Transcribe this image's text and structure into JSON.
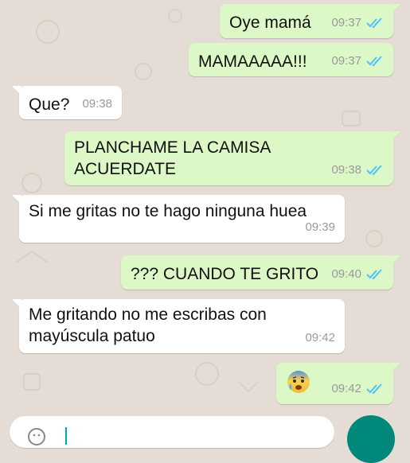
{
  "chat": {
    "messages": [
      {
        "dir": "out",
        "text": "Oye mamá",
        "time": "09:37",
        "status": "read"
      },
      {
        "dir": "out",
        "text": "MAMAAAAA!!!",
        "time": "09:37",
        "status": "read"
      },
      {
        "dir": "in",
        "text": "Que?",
        "time": "09:38"
      },
      {
        "dir": "out",
        "line1": "PLANCHAME LA CAMISA",
        "line2": "ACUERDATE",
        "time": "09:38",
        "status": "read"
      },
      {
        "dir": "in",
        "text": "Si me gritas no te hago ninguna huea",
        "time": "09:39"
      },
      {
        "dir": "out",
        "text": "??? CUANDO TE GRITO",
        "time": "09:40",
        "status": "read"
      },
      {
        "dir": "in",
        "line1": "Me gritando no me escribas con",
        "line2": "mayúscula patuo",
        "time": "09:42"
      },
      {
        "dir": "out",
        "emoji": "anxious-face-with-sweat",
        "time": "09:42",
        "status": "read"
      }
    ]
  },
  "colors": {
    "outgoing_bubble": "#dcf8c6",
    "incoming_bubble": "#ffffff",
    "read_ticks": "#4fc3f7",
    "background": "#e5ddd5",
    "send_button": "#00897b"
  },
  "icons": {
    "read_receipt": "double-check-icon",
    "composer_emoji": "emoji-icon"
  }
}
